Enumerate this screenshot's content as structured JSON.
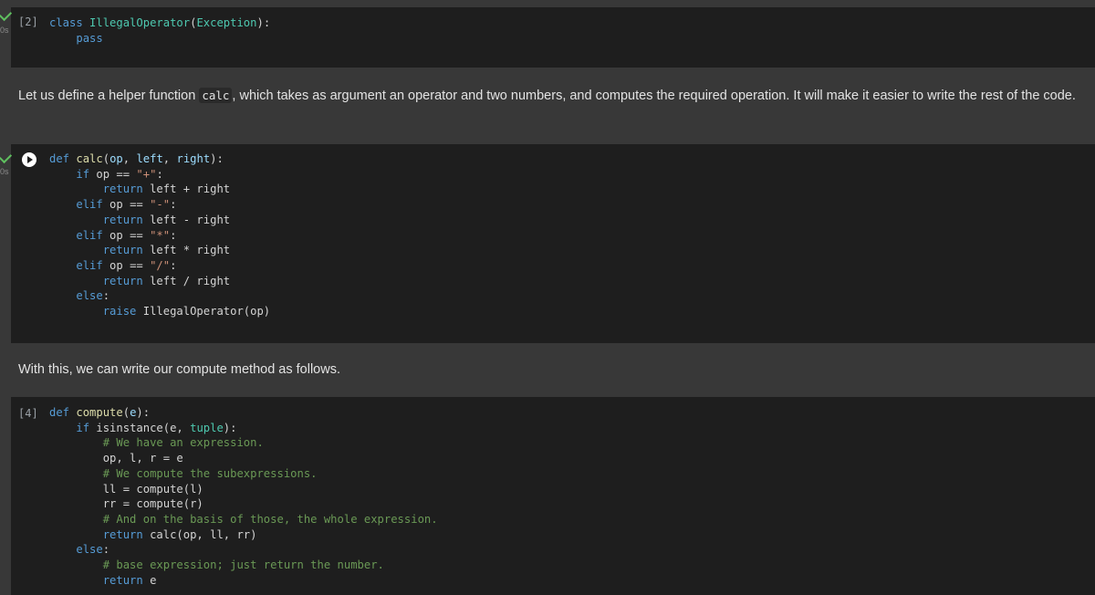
{
  "cells": [
    {
      "type": "code",
      "exec_count": "[2]",
      "status_time": "0s",
      "lines": [
        [
          {
            "c": "kw",
            "t": "class "
          },
          {
            "c": "cls",
            "t": "IllegalOperator"
          },
          {
            "c": "",
            "t": "("
          },
          {
            "c": "cls",
            "t": "Exception"
          },
          {
            "c": "",
            "t": "):"
          }
        ],
        [
          {
            "c": "",
            "t": "    "
          },
          {
            "c": "kw",
            "t": "pass"
          }
        ]
      ]
    },
    {
      "type": "markdown",
      "before": "Let us define a helper function ",
      "code": "calc",
      "after": ", which takes as argument an operator and two numbers, and computes the required operation. It will make it easier to write the rest of the code."
    },
    {
      "type": "code",
      "exec_count": "",
      "status_time": "0s",
      "lines": [
        [
          {
            "c": "kw",
            "t": "def "
          },
          {
            "c": "fn",
            "t": "calc"
          },
          {
            "c": "",
            "t": "("
          },
          {
            "c": "prm",
            "t": "op"
          },
          {
            "c": "",
            "t": ", "
          },
          {
            "c": "prm",
            "t": "left"
          },
          {
            "c": "",
            "t": ", "
          },
          {
            "c": "prm",
            "t": "right"
          },
          {
            "c": "",
            "t": "):"
          }
        ],
        [
          {
            "c": "",
            "t": "    "
          },
          {
            "c": "kw",
            "t": "if"
          },
          {
            "c": "",
            "t": " op == "
          },
          {
            "c": "str",
            "t": "\"+\""
          },
          {
            "c": "",
            "t": ":"
          }
        ],
        [
          {
            "c": "",
            "t": "        "
          },
          {
            "c": "kw",
            "t": "return"
          },
          {
            "c": "",
            "t": " left + right"
          }
        ],
        [
          {
            "c": "",
            "t": "    "
          },
          {
            "c": "kw",
            "t": "elif"
          },
          {
            "c": "",
            "t": " op == "
          },
          {
            "c": "str",
            "t": "\"-\""
          },
          {
            "c": "",
            "t": ":"
          }
        ],
        [
          {
            "c": "",
            "t": "        "
          },
          {
            "c": "kw",
            "t": "return"
          },
          {
            "c": "",
            "t": " left - right"
          }
        ],
        [
          {
            "c": "",
            "t": "    "
          },
          {
            "c": "kw",
            "t": "elif"
          },
          {
            "c": "",
            "t": " op == "
          },
          {
            "c": "str",
            "t": "\"*\""
          },
          {
            "c": "",
            "t": ":"
          }
        ],
        [
          {
            "c": "",
            "t": "        "
          },
          {
            "c": "kw",
            "t": "return"
          },
          {
            "c": "",
            "t": " left * right"
          }
        ],
        [
          {
            "c": "",
            "t": "    "
          },
          {
            "c": "kw",
            "t": "elif"
          },
          {
            "c": "",
            "t": " op == "
          },
          {
            "c": "str",
            "t": "\"/\""
          },
          {
            "c": "",
            "t": ":"
          }
        ],
        [
          {
            "c": "",
            "t": "        "
          },
          {
            "c": "kw",
            "t": "return"
          },
          {
            "c": "",
            "t": " left / right"
          }
        ],
        [
          {
            "c": "",
            "t": "    "
          },
          {
            "c": "kw",
            "t": "else"
          },
          {
            "c": "",
            "t": ":"
          }
        ],
        [
          {
            "c": "",
            "t": "        "
          },
          {
            "c": "kw",
            "t": "raise"
          },
          {
            "c": "",
            "t": " IllegalOperator(op)"
          }
        ]
      ]
    },
    {
      "type": "markdown",
      "before": "With this, we can write our compute method as follows.",
      "code": "",
      "after": ""
    },
    {
      "type": "code",
      "exec_count": "[4]",
      "status_time": "",
      "lines": [
        [
          {
            "c": "kw",
            "t": "def "
          },
          {
            "c": "fn",
            "t": "compute"
          },
          {
            "c": "",
            "t": "("
          },
          {
            "c": "prm",
            "t": "e"
          },
          {
            "c": "",
            "t": "):"
          }
        ],
        [
          {
            "c": "",
            "t": "    "
          },
          {
            "c": "kw",
            "t": "if"
          },
          {
            "c": "",
            "t": " isinstance(e, "
          },
          {
            "c": "cls",
            "t": "tuple"
          },
          {
            "c": "",
            "t": "):"
          }
        ],
        [
          {
            "c": "",
            "t": "        "
          },
          {
            "c": "cm",
            "t": "# We have an expression."
          }
        ],
        [
          {
            "c": "",
            "t": "        op, l, r = e"
          }
        ],
        [
          {
            "c": "",
            "t": "        "
          },
          {
            "c": "cm",
            "t": "# We compute the subexpressions."
          }
        ],
        [
          {
            "c": "",
            "t": "        ll = compute(l)"
          }
        ],
        [
          {
            "c": "",
            "t": "        rr = compute(r)"
          }
        ],
        [
          {
            "c": "",
            "t": "        "
          },
          {
            "c": "cm",
            "t": "# And on the basis of those, the whole expression."
          }
        ],
        [
          {
            "c": "",
            "t": "        "
          },
          {
            "c": "kw",
            "t": "return"
          },
          {
            "c": "",
            "t": " calc(op, ll, rr)"
          }
        ],
        [
          {
            "c": "",
            "t": "    "
          },
          {
            "c": "kw",
            "t": "else"
          },
          {
            "c": "",
            "t": ":"
          }
        ],
        [
          {
            "c": "",
            "t": "        "
          },
          {
            "c": "cm",
            "t": "# base expression; just return the number."
          }
        ],
        [
          {
            "c": "",
            "t": "        "
          },
          {
            "c": "kw",
            "t": "return"
          },
          {
            "c": "",
            "t": " e"
          }
        ]
      ]
    }
  ]
}
